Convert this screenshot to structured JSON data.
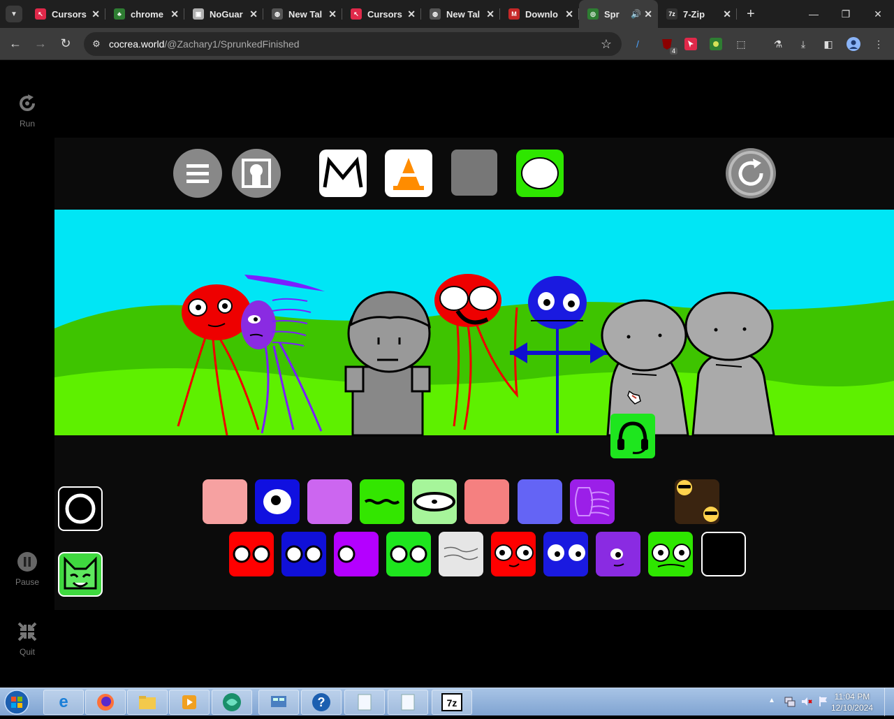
{
  "browser": {
    "tabs": [
      {
        "title": "Cursors",
        "fav_color": "#e0294a",
        "fav_glyph": "↖"
      },
      {
        "title": "chrome",
        "fav_color": "#2e7d32",
        "fav_glyph": "♣"
      },
      {
        "title": "NoGuar",
        "fav_color": "#b0b0b0",
        "fav_glyph": "▣"
      },
      {
        "title": "New Tal",
        "fav_color": "#555555",
        "fav_glyph": "◍"
      },
      {
        "title": "Cursors",
        "fav_color": "#e0294a",
        "fav_glyph": "↖"
      },
      {
        "title": "New Tal",
        "fav_color": "#555555",
        "fav_glyph": "◍"
      },
      {
        "title": "Downlo",
        "fav_color": "#c62828",
        "fav_glyph": "M"
      },
      {
        "title": "Spr",
        "fav_color": "#2e7d32",
        "fav_glyph": "◎",
        "active": true,
        "audio": "🔊"
      },
      {
        "title": "7-Zip",
        "fav_color": "#333333",
        "fav_glyph": "7z"
      }
    ],
    "new_tab": "+",
    "url_host": "cocrea.world",
    "url_path": "/@Zachary1/SprunkedFinished",
    "ext_badge": "4"
  },
  "sidebar": {
    "run_label": "Run",
    "pause_label": "Pause",
    "quit_label": "Quit"
  },
  "taskbar": {
    "time": "11:04 PM",
    "date": "12/10/2024"
  },
  "colors": {
    "sky": "#00e6f5",
    "grass_dark": "#3ec400",
    "grass_light": "#5ef000"
  }
}
